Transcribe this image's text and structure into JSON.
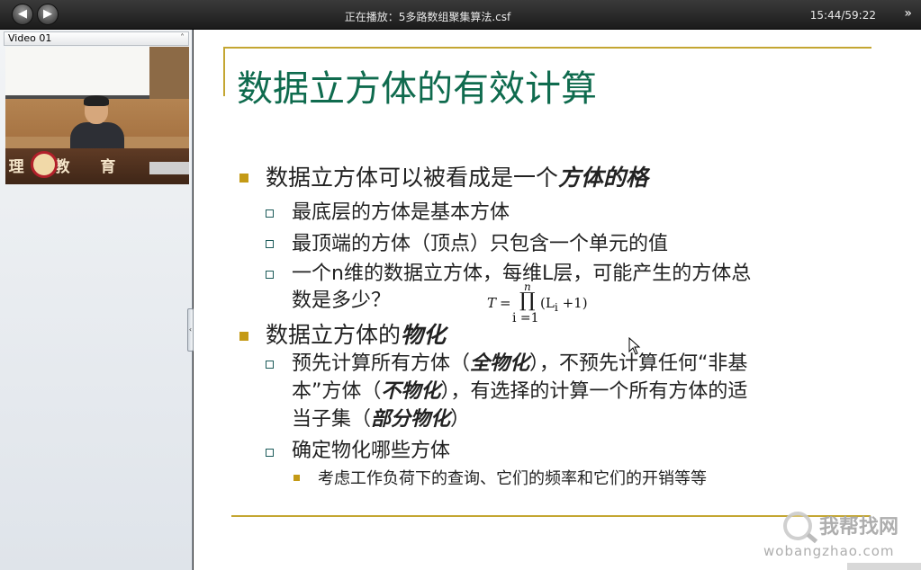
{
  "titlebar": {
    "back_icon": "left-arrow-icon",
    "forward_icon": "right-arrow-icon",
    "title": "正在播放：5多路数组聚集算法.csf",
    "time": "15:44/59:22",
    "more_label": "»"
  },
  "left_panel": {
    "header_label": "Video 01",
    "collapse_label": "˄",
    "splitter_label": "‹",
    "desk_text": "理 教 育"
  },
  "slide": {
    "title": "数据立方体的有效计算",
    "b1_text": "数据立方体可以被看成是一个",
    "b1_em": "方体的格",
    "b1_sub1": "最底层的方体是基本方体",
    "b1_sub2": "最顶端的方体（顶点）只包含一个单元的值",
    "b1_sub3_line1": "一个n维的数据立方体，每维L层，可能产生的方体总",
    "b1_sub3_line2": "数是多少？",
    "formula_T": "T",
    "formula_eq": "=",
    "formula_n": "n",
    "formula_prod": "∏",
    "formula_lower": "i =1",
    "formula_body": "(L",
    "formula_sub": "i",
    "formula_tail": " +1)",
    "b2_text": "数据立方体的",
    "b2_em": "物化",
    "b2_sub1_a": "预先计算所有方体（",
    "b2_sub1_em1": "全物化",
    "b2_sub1_b": "），不预先计算任何“非基",
    "b2_sub1_c": "本”方体（",
    "b2_sub1_em2": "不物化",
    "b2_sub1_d": "），有选择的计算一个所有方体的适",
    "b2_sub1_e": "当子集（",
    "b2_sub1_em3": "部分物化",
    "b2_sub1_f": "）",
    "b2_sub2": "确定物化哪些方体",
    "b2_sub2_sub1": "考虑工作负荷下的查询、它们的频率和它们的开销等等"
  },
  "watermark": {
    "text": "我帮找网",
    "domain": "wobangzhao.com"
  },
  "colors": {
    "title_green": "#0f6b4e",
    "rule_gold": "#c4a632",
    "bullet_gold": "#c49a16"
  }
}
